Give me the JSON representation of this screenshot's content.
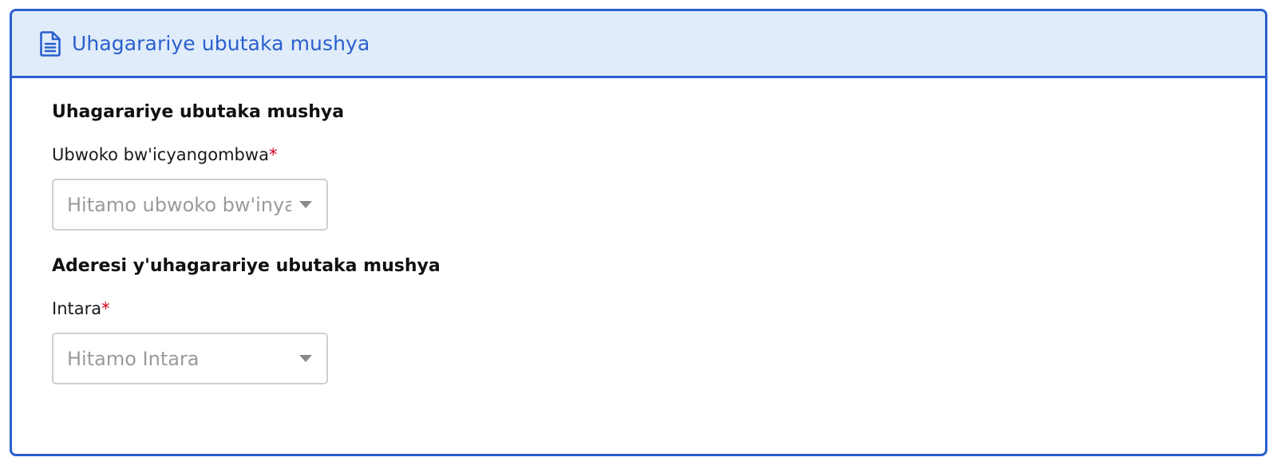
{
  "header": {
    "icon": "document-icon",
    "title": "Uhagarariye ubutaka mushya"
  },
  "section1": {
    "title": "Uhagarariye ubutaka mushya",
    "field": {
      "label": "Ubwoko bw'icyangombwa",
      "required_mark": "*",
      "placeholder": "Hitamo ubwoko bw'inya"
    }
  },
  "section2": {
    "title": "Aderesi y'uhagarariye ubutaka mushya",
    "field": {
      "label": "Intara",
      "required_mark": "*",
      "placeholder": "Hitamo Intara"
    }
  },
  "colors": {
    "accent": "#2a5fcf",
    "header_bg": "#e0ecf9",
    "required": "#d0021b"
  }
}
